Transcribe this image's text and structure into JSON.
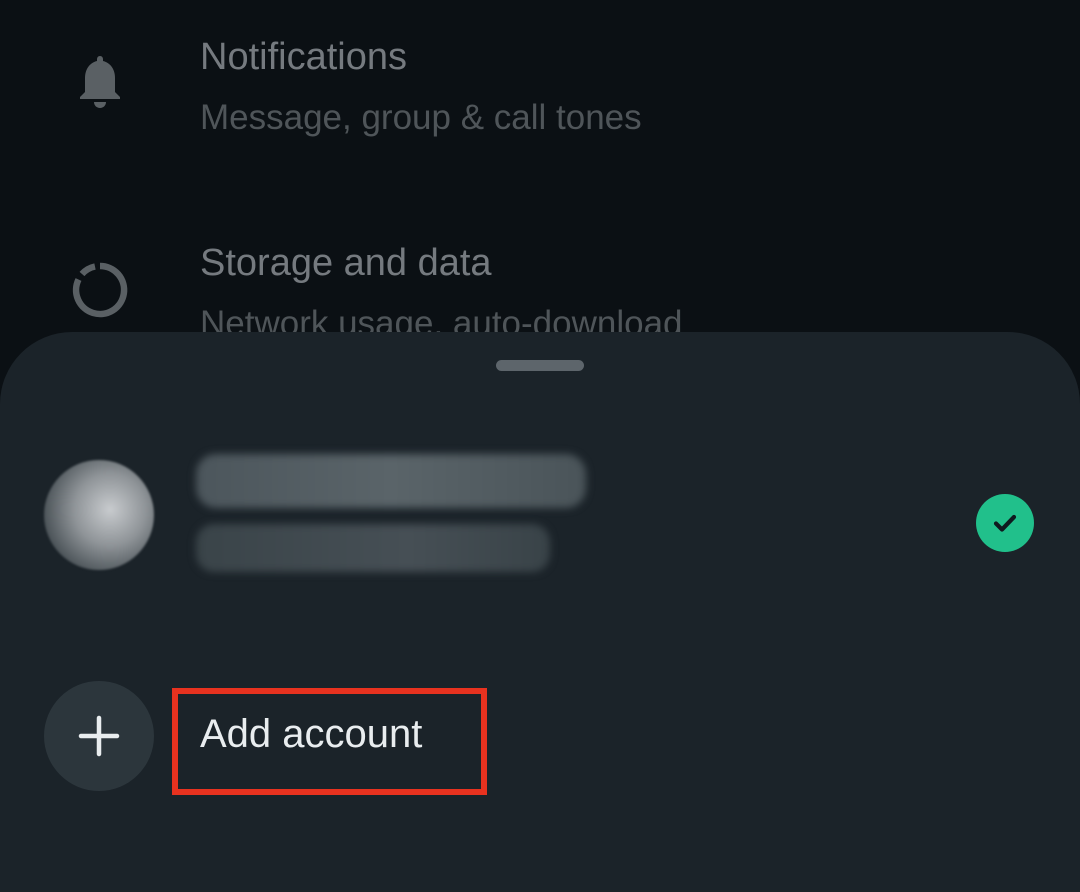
{
  "settings": {
    "items": [
      {
        "icon": "bell-icon",
        "title": "Notifications",
        "subtitle": "Message, group & call tones"
      },
      {
        "icon": "storage-ring-icon",
        "title": "Storage and data",
        "subtitle": "Network usage, auto-download"
      }
    ]
  },
  "sheet": {
    "account": {
      "name": "",
      "phone": "",
      "avatar_icon": "avatar",
      "selected_icon": "check-circle-icon"
    },
    "add_account": {
      "icon": "plus-icon",
      "label": "Add account"
    }
  },
  "colors": {
    "background": "#0b1014",
    "sheet": "#1b2329",
    "accent_green": "#21c08b",
    "highlight_red": "#e8321f"
  }
}
